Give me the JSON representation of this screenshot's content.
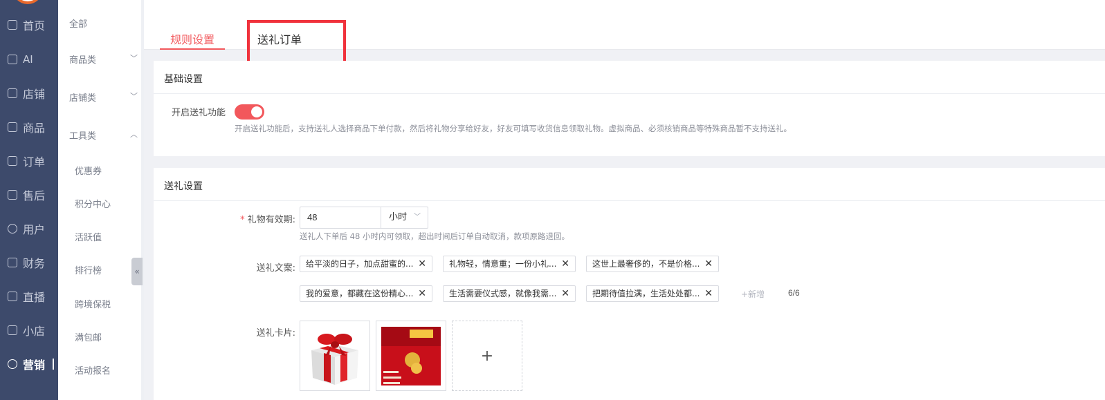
{
  "nav": {
    "items": [
      {
        "label": "首页",
        "icon": "home-icon"
      },
      {
        "label": "AI",
        "icon": "robot-icon"
      },
      {
        "label": "店铺",
        "icon": "store-icon"
      },
      {
        "label": "商品",
        "icon": "bag-icon"
      },
      {
        "label": "订单",
        "icon": "order-icon"
      },
      {
        "label": "售后",
        "icon": "aftersale-icon"
      },
      {
        "label": "用户",
        "icon": "user-icon"
      },
      {
        "label": "财务",
        "icon": "wallet-icon"
      },
      {
        "label": "直播",
        "icon": "live-icon"
      },
      {
        "label": "小店",
        "icon": "shop-icon"
      },
      {
        "label": "营销",
        "icon": "marketing-icon"
      }
    ],
    "active": "营销"
  },
  "submenu": {
    "all": "全部",
    "groups": [
      {
        "label": "商品类",
        "expanded": false
      },
      {
        "label": "店铺类",
        "expanded": false
      },
      {
        "label": "工具类",
        "expanded": true
      }
    ],
    "tools": [
      "优惠券",
      "积分中心",
      "活跃值",
      "排行榜",
      "跨境保税",
      "满包邮",
      "活动报名"
    ],
    "collapse_glyph": "«"
  },
  "tabs": {
    "rule_settings": "规则设置",
    "gift_orders": "送礼订单",
    "active": "规则设置"
  },
  "basic": {
    "title": "基础设置",
    "enable_label": "开启送礼功能",
    "enable_on": true,
    "enable_hint": "开启送礼功能后，支持送礼人选择商品下单付款，然后将礼物分享给好友，好友可填写收货信息领取礼物。虚拟商品、必须核销商品等特殊商品暂不支持送礼。"
  },
  "gift": {
    "title": "送礼设置",
    "validity_label": "礼物有效期:",
    "validity_value": "48",
    "validity_unit": "小时",
    "validity_hint": "送礼人下单后 48 小时内可领取，超出时间后订单自动取消，款项原路退回。",
    "copy_label": "送礼文案:",
    "copies": [
      "给平淡的日子，加点甜蜜的...",
      "礼物轻，情意重；一份小礼...",
      "这世上最奢侈的，不是价格...",
      "我的爱意，都藏在这份精心...",
      "生活需要仪式感，就像我需...",
      "把期待值拉满，生活处处都..."
    ],
    "add_label": "+新增",
    "count": "6/6",
    "card_label": "送礼卡片:",
    "add_card": "+"
  },
  "colors": {
    "accent": "#f2585c",
    "nav_bg": "#3d4a6b",
    "highlight": "#f0323c"
  }
}
